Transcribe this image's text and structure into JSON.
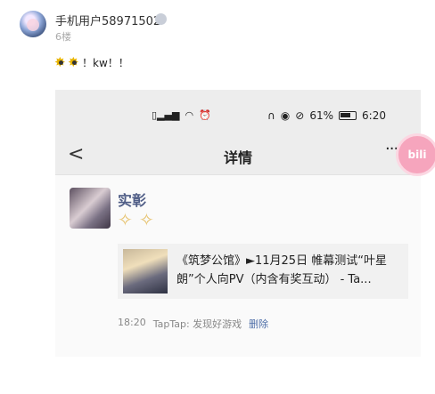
{
  "post": {
    "username": "手机用户58971502",
    "floor": "6楼",
    "content_text": "！kw！！"
  },
  "screenshot": {
    "status_time": "6:20",
    "battery": "61%",
    "page_title": "详情",
    "back_glyph": "<",
    "more_glyph": "···",
    "author_name": "实彰",
    "link_title": "《筑梦公馆》►11月25日 帷幕测试“叶星朗”个人向PV（内含有奖互动） - Ta...",
    "meta_time": "18:20",
    "meta_source": "TapTap: 发现好游戏",
    "meta_delete": "删除"
  },
  "floating_badge": {
    "label": "bili"
  },
  "icons": {
    "network_icon": "hd-4g-signal-icon",
    "wifi_icon": "wifi-icon",
    "alarm_icon": "alarm-icon",
    "headphone_icon": "headphone-icon",
    "eye_icon": "eye-icon",
    "mute_icon": "mute-icon",
    "battery_icon": "battery-icon"
  },
  "colors": {
    "name_blue": "#4f5d86",
    "delete_link": "#4f6fa8",
    "statusbar_bg": "#ededed",
    "bili_pink": "#f6a5bd"
  }
}
